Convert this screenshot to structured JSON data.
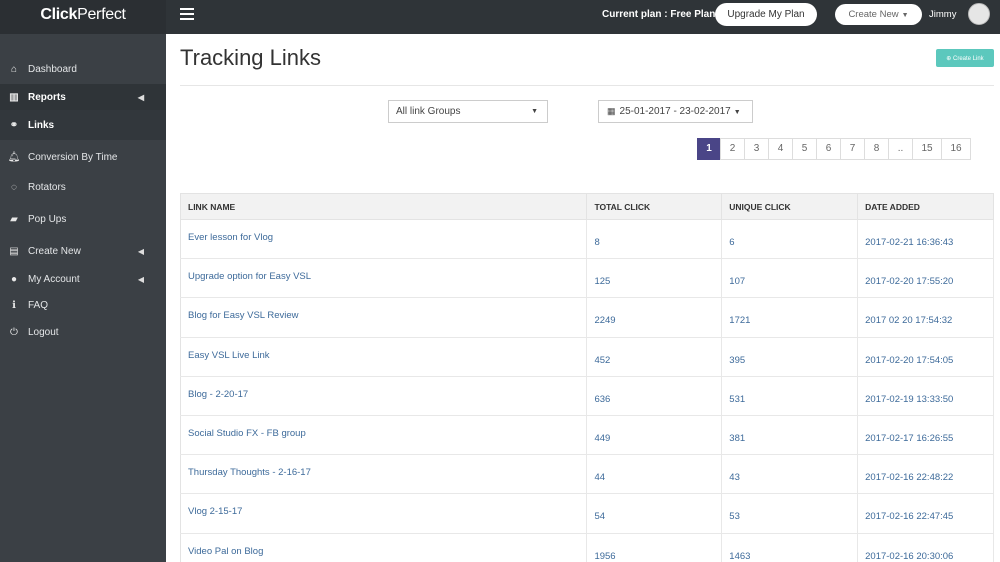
{
  "brand": {
    "bold": "Click",
    "thin": "Perfect"
  },
  "topbar": {
    "plan_text": "Current plan : Free Plan",
    "upgrade_label": "Upgrade My Plan",
    "create_new_label": "Create New",
    "user_name": "Jimmy"
  },
  "sidebar": {
    "items": [
      {
        "label": "Dashboard",
        "icon": "home-icon"
      },
      {
        "label": "Reports",
        "icon": "bar-chart-icon"
      },
      {
        "label": "Links",
        "icon": "link-icon"
      },
      {
        "label": "Conversion By Time",
        "icon": "bell-icon"
      },
      {
        "label": "Rotators",
        "icon": "spinner-icon"
      },
      {
        "label": "Pop Ups",
        "icon": "chat-icon"
      },
      {
        "label": "Create New",
        "icon": "file-icon"
      },
      {
        "label": "My Account",
        "icon": "user-icon"
      },
      {
        "label": "FAQ",
        "icon": "info-icon"
      },
      {
        "label": "Logout",
        "icon": "power-icon"
      }
    ]
  },
  "main": {
    "title": "Tracking Links",
    "create_link_label": "⊕ Create Link",
    "group_select": "All link Groups",
    "date_range": "25-01-2017 - 23-02-2017",
    "pages": [
      "1",
      "2",
      "3",
      "4",
      "5",
      "6",
      "7",
      "8",
      "..",
      "15",
      "16"
    ],
    "active_page": "1"
  },
  "table": {
    "headers": [
      "LINK NAME",
      "TOTAL CLICK",
      "UNIQUE CLICK",
      "DATE ADDED"
    ],
    "rows": [
      {
        "name": "Ever lesson for Vlog",
        "total": "8",
        "unique": "6",
        "date": "2017-02-21 16:36:43"
      },
      {
        "name": "Upgrade option for Easy VSL",
        "total": "125",
        "unique": "107",
        "date": "2017-02-20 17:55:20"
      },
      {
        "name": "Blog for Easy VSL Review",
        "total": "2249",
        "unique": "1721",
        "date": "2017 02 20 17:54:32"
      },
      {
        "name": "Easy VSL Live Link",
        "total": "452",
        "unique": "395",
        "date": "2017-02-20 17:54:05"
      },
      {
        "name": "Blog - 2-20-17",
        "total": "636",
        "unique": "531",
        "date": "2017-02-19 13:33:50"
      },
      {
        "name": "Social Studio FX - FB group",
        "total": "449",
        "unique": "381",
        "date": "2017-02-17 16:26:55"
      },
      {
        "name": "Thursday Thoughts - 2-16-17",
        "total": "44",
        "unique": "43",
        "date": "2017-02-16 22:48:22"
      },
      {
        "name": "Vlog 2-15-17",
        "total": "54",
        "unique": "53",
        "date": "2017-02-16 22:47:45"
      },
      {
        "name": "Video Pal on Blog",
        "total": "1956",
        "unique": "1463",
        "date": "2017-02-16 20:30:06"
      }
    ]
  }
}
